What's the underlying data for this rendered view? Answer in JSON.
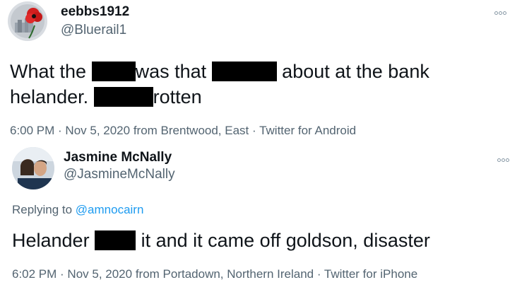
{
  "tweet1": {
    "name": "eebbs1912",
    "handle": "@Bluerail1",
    "line1_a": "What the",
    "line1_b": "was that",
    "line1_c": "about at the bank",
    "line2_a": "helander.",
    "line2_b": "rotten",
    "meta": "6:00 PM · Nov 5, 2020 from Brentwood, East · Twitter for Android"
  },
  "tweet2": {
    "name": "Jasmine McNally",
    "handle": "@JasmineMcNally",
    "replying_prefix": "Replying to",
    "replying_to": "@amnocairn",
    "text_a": "Helander",
    "text_b": "it and it came off goldson, disaster",
    "meta": "6:02 PM · Nov 5, 2020 from Portadown, Northern Ireland · Twitter for iPhone"
  },
  "icons": {
    "more": "more-options-icon",
    "poppy": "poppy-avatar"
  },
  "colors": {
    "link": "#1d9bf0",
    "secondary_text": "#536471",
    "redaction": "#000000"
  }
}
